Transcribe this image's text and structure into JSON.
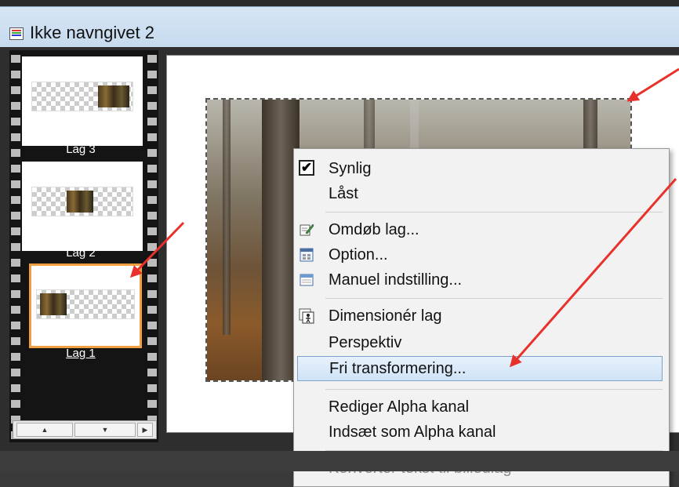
{
  "window": {
    "title": "Ikke navngivet 2"
  },
  "layers": [
    {
      "label": "Lag 3",
      "selected": false
    },
    {
      "label": "Lag 2",
      "selected": false
    },
    {
      "label": "Lag 1",
      "selected": true
    }
  ],
  "scrollbar": {
    "up_glyph": "▲",
    "down_glyph": "▼",
    "right_glyph": "▶"
  },
  "context_menu": {
    "synlig": {
      "label": "Synlig",
      "checked": true,
      "check_glyph": "✔"
    },
    "laast": {
      "label": "Låst"
    },
    "omdoeb": {
      "label": "Omdøb lag...",
      "icon": "rename-icon"
    },
    "option": {
      "label": "Option...",
      "icon": "options-icon"
    },
    "manuel": {
      "label": "Manuel indstilling...",
      "icon": "window-icon"
    },
    "dimensioner": {
      "label": "Dimensionér lag",
      "icon": "resize-icon"
    },
    "perspektiv": {
      "label": "Perspektiv"
    },
    "fri": {
      "label": "Fri transformering...",
      "highlighted": true
    },
    "rediger_alpha": {
      "label": "Rediger Alpha kanal"
    },
    "indsaet_alpha": {
      "label": "Indsæt som Alpha kanal"
    },
    "konverter": {
      "label": "Konverter tekst til billedlag",
      "disabled": true
    }
  },
  "annotation_color": "#e8312a",
  "selection_color": "#f0a040"
}
